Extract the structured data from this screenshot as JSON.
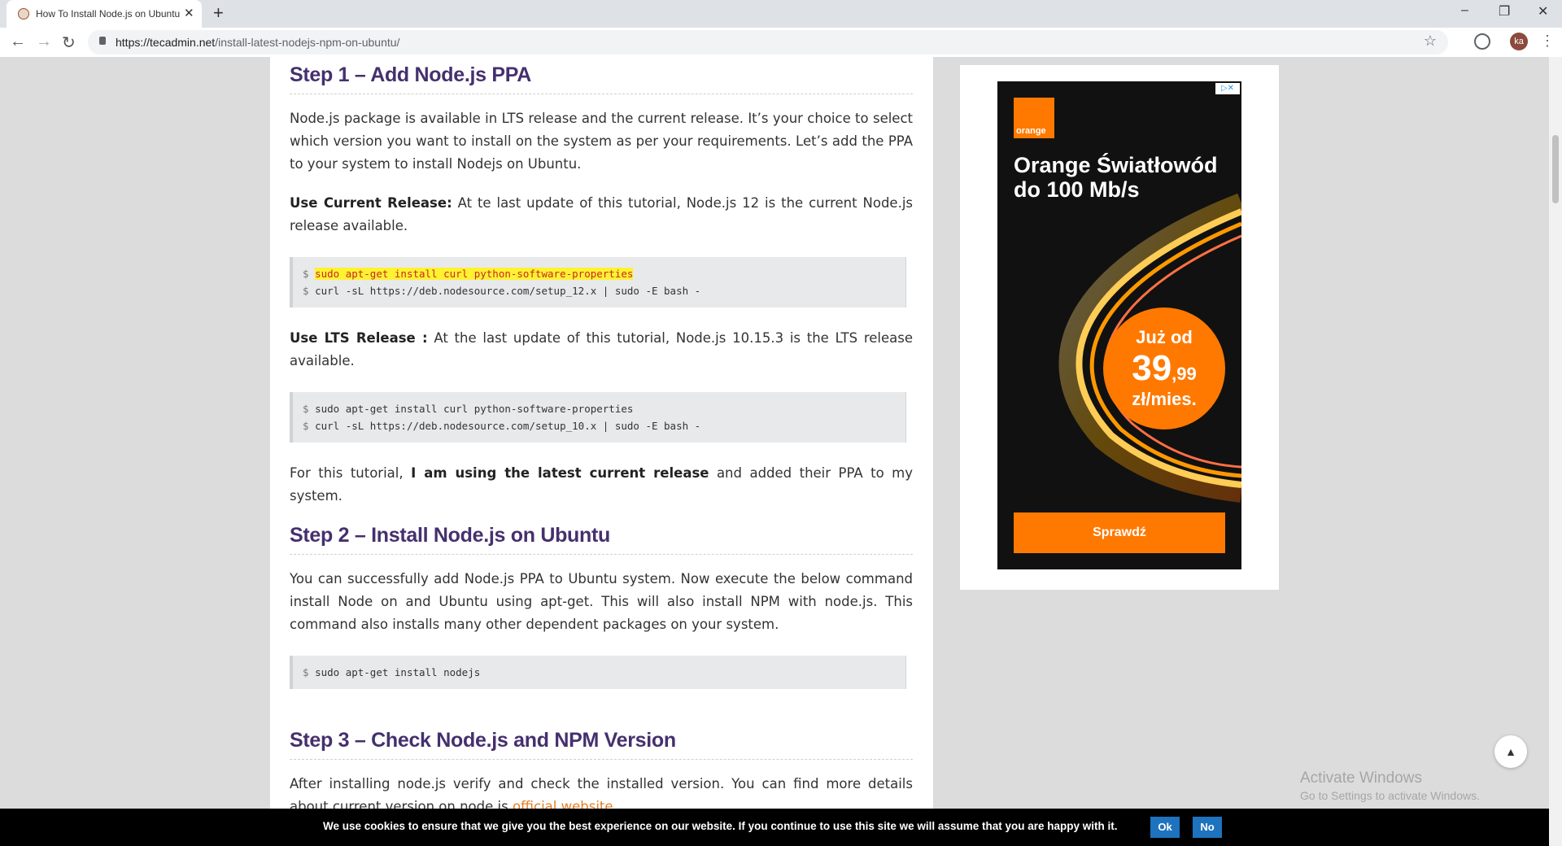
{
  "browser": {
    "tab_title": "How To Install Node.js on Ubuntu",
    "url_domain": "https://tecadmin.net",
    "url_path": "/install-latest-nodejs-npm-on-ubuntu/",
    "avatar": "ka",
    "icons": [
      "back-icon",
      "forward-icon",
      "reload-icon",
      "lock-icon",
      "star-icon",
      "extension-icon",
      "menu-icon",
      "minimize-icon",
      "maximize-icon",
      "close-icon"
    ]
  },
  "article": {
    "step1": {
      "heading": "Step 1 – Add Node.js PPA",
      "intro": "Node.js package is available in LTS release and the current release. It’s your choice to select which version you want to install on the system as per your requirements. Let’s add the PPA to your system to install Nodejs on Ubuntu.",
      "current_label": "Use Current Release:",
      "current_text": " At te last update of this tutorial, Node.js 12 is the current Node.js release available.",
      "current_code": [
        "sudo apt-get install curl python-software-properties",
        "curl -sL https://deb.nodesource.com/setup_12.x | sudo -E bash -"
      ],
      "lts_label": "Use LTS Release :",
      "lts_text": " At the last update of this tutorial, Node.js 10.15.3 is the LTS release available.",
      "lts_code": [
        "sudo apt-get install curl python-software-properties",
        "curl -sL https://deb.nodesource.com/setup_10.x | sudo -E bash -"
      ],
      "note_pre": "For this tutorial, ",
      "note_bold": "I am using the latest current release",
      "note_post": " and added their PPA to my system."
    },
    "step2": {
      "heading": "Step 2 – Install Node.js on Ubuntu",
      "text": "You can successfully add Node.js PPA to Ubuntu system. Now execute the below command install Node on and Ubuntu using apt-get. This will also install NPM with node.js. This command also installs many other dependent packages on your system.",
      "code": [
        "sudo apt-get install nodejs"
      ]
    },
    "step3": {
      "heading": "Step 3 – Check Node.js and NPM Version",
      "text_pre": "After installing node.js verify and check the installed version. You can find more details about current version on node.js ",
      "link": "official website",
      "text_post": "."
    },
    "prompt": "$"
  },
  "ad": {
    "logo": "orange",
    "headline": "Orange Światłowód do 100 Mb/s",
    "price_prefix": "Już od",
    "price_main": "39",
    "price_cents": ",99",
    "price_unit": "zł/mies.",
    "cta": "Sprawdź",
    "brand_color": "#ff7900"
  },
  "activate_windows": {
    "title": "Activate Windows",
    "subtitle": "Go to Settings to activate Windows."
  },
  "cookie": {
    "message": "We use cookies to ensure that we give you the best experience on our website. If you continue to use this site we will assume that you are happy with it.",
    "ok": "Ok",
    "no": "No"
  }
}
